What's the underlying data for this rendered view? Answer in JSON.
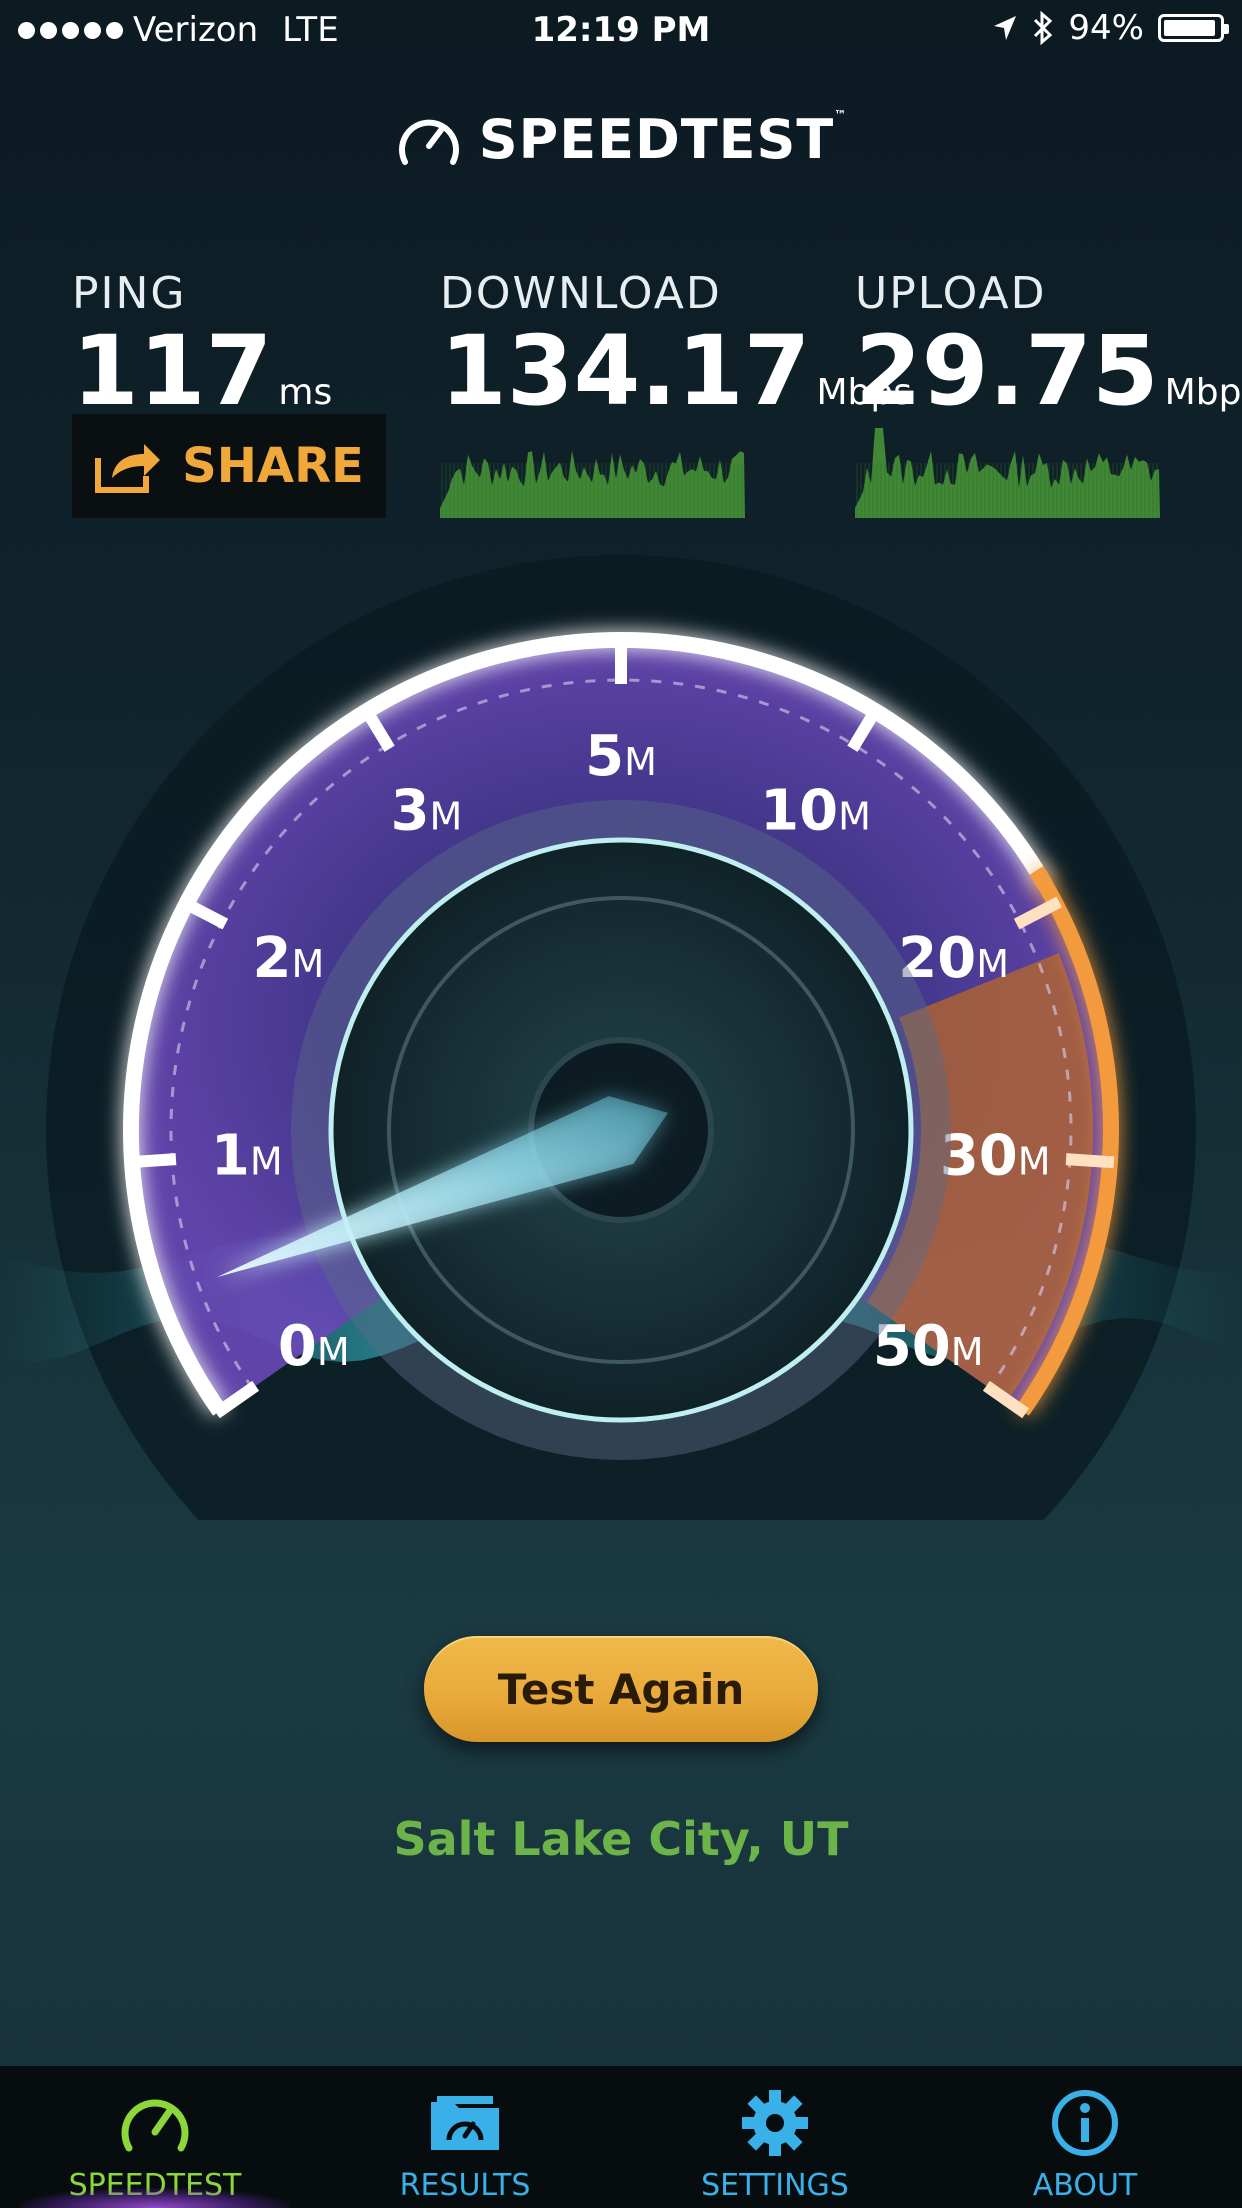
{
  "status_bar": {
    "carrier": "Verizon",
    "network": "LTE",
    "time": "12:19 PM",
    "battery": "94%",
    "battery_level": 0.94
  },
  "brand": {
    "title": "SPEEDTEST",
    "trademark": "™"
  },
  "metrics": {
    "ping": {
      "label": "PING",
      "value": "117",
      "unit": "ms"
    },
    "download": {
      "label": "DOWNLOAD",
      "value": "134.17",
      "unit": "Mbps"
    },
    "upload": {
      "label": "UPLOAD",
      "value": "29.75",
      "unit": "Mbps"
    }
  },
  "share": {
    "label": "SHARE"
  },
  "gauge": {
    "ticks": [
      {
        "num": "0",
        "suffix": "M"
      },
      {
        "num": "1",
        "suffix": "M"
      },
      {
        "num": "2",
        "suffix": "M"
      },
      {
        "num": "3",
        "suffix": "M"
      },
      {
        "num": "5",
        "suffix": "M"
      },
      {
        "num": "10",
        "suffix": "M"
      },
      {
        "num": "20",
        "suffix": "M"
      },
      {
        "num": "30",
        "suffix": "M"
      },
      {
        "num": "50",
        "suffix": "M"
      }
    ],
    "needle_fraction": 0.06
  },
  "actions": {
    "test_again": "Test Again"
  },
  "location": "Salt Lake City, UT",
  "tabs": [
    {
      "label": "SPEEDTEST",
      "icon": "gauge-icon",
      "active": true
    },
    {
      "label": "RESULTS",
      "icon": "results-folder-icon",
      "active": false
    },
    {
      "label": "SETTINGS",
      "icon": "gear-icon",
      "active": false
    },
    {
      "label": "ABOUT",
      "icon": "info-icon",
      "active": false
    }
  ],
  "colors": {
    "accent_orange": "#f0a83a",
    "arc_orange": "#f29a3c",
    "tab_blue": "#3ab0e8",
    "tab_active_green": "#8cd83a",
    "location_green": "#6cb34a",
    "gauge_purple": "#5a3fa8",
    "spark_green": "#4a9a3a"
  }
}
